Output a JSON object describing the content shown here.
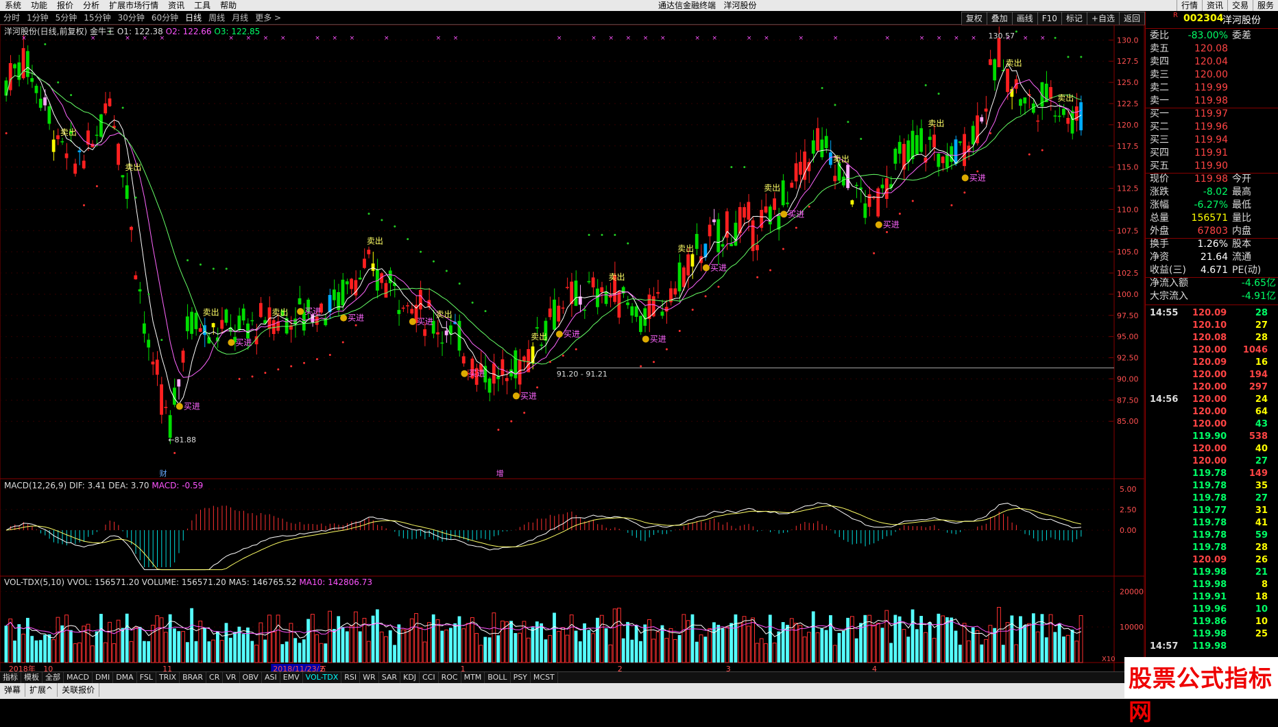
{
  "menu": {
    "items": [
      "系统",
      "功能",
      "报价",
      "分析",
      "扩展市场行情",
      "资讯",
      "工具",
      "帮助"
    ],
    "center_title": "通达信金融终端",
    "center_stock": "洋河股份",
    "right_items": [
      "行情",
      "资讯",
      "交易",
      "服务"
    ]
  },
  "period_tabs": [
    "分时",
    "1分钟",
    "5分钟",
    "15分钟",
    "30分钟",
    "60分钟",
    "日线",
    "周线",
    "月线",
    "更多 >"
  ],
  "active_period": "日线",
  "right_tools": [
    "复权",
    "叠加",
    "画线",
    "F10",
    "标记",
    "+自选",
    "返回"
  ],
  "price_chart": {
    "title_main": "洋河股份(日线,前复权)",
    "title_indicator": "金牛王",
    "o1_label": "O1: 122.38",
    "o2_label": "O2: 122.66",
    "o3_label": "O3: 122.85",
    "y_ticks": [
      "130.0",
      "127.5",
      "125.0",
      "122.5",
      "120.0",
      "117.5",
      "115.0",
      "112.5",
      "110.0",
      "107.5",
      "105.0",
      "102.5",
      "100.0",
      "97.50",
      "95.00",
      "92.50",
      "90.00",
      "87.50",
      "85.00"
    ],
    "low_label": "←81.88",
    "high_label": "130.57",
    "mid_label": "91.20 - 91.21",
    "buy_text": "买进",
    "sell_text": "卖出",
    "finance_marker": "财",
    "add_marker": "增"
  },
  "macd": {
    "title": "MACD(12,26,9)",
    "dif": "DIF: 3.41",
    "dea": "DEA: 3.70",
    "macd": "MACD: -0.59",
    "y_ticks": [
      "5.00",
      "2.50",
      "0.00"
    ]
  },
  "volume": {
    "title": "VOL-TDX(5,10)",
    "vvol": "VVOL: 156571.20",
    "volume": "VOLUME: 156571.20",
    "ma5": "MA5: 146765.52",
    "ma10": "MA10: 142806.73",
    "y_ticks": [
      "20000",
      "10000"
    ],
    "unit": "X10"
  },
  "x_axis": {
    "labels": [
      "2018年",
      "10",
      "11",
      "2018/11/23/五",
      "2",
      "1",
      "2",
      "3",
      "4"
    ]
  },
  "indicator_tabs": [
    "指标",
    "模板",
    "全部",
    "MACD",
    "DMI",
    "DMA",
    "FSL",
    "TRIX",
    "BRAR",
    "CR",
    "VR",
    "OBV",
    "ASI",
    "EMV",
    "VOL-TDX",
    "RSI",
    "WR",
    "SAR",
    "KDJ",
    "CCI",
    "ROC",
    "MTM",
    "BOLL",
    "PSY",
    "MCST"
  ],
  "active_indicator_tab": "VOL-TDX",
  "status_items": [
    "弹幕",
    "扩展^",
    "关联报价"
  ],
  "quote_panel": {
    "mark": "R",
    "code": "002304",
    "name": "洋河股份",
    "weibi_label": "委比",
    "weibi": "-83.00%",
    "weicha_label": "委差",
    "asks": [
      {
        "label": "卖五",
        "price": "120.08"
      },
      {
        "label": "卖四",
        "price": "120.04"
      },
      {
        "label": "卖三",
        "price": "120.00"
      },
      {
        "label": "卖二",
        "price": "119.99"
      },
      {
        "label": "卖一",
        "price": "119.98"
      }
    ],
    "bids": [
      {
        "label": "买一",
        "price": "119.97"
      },
      {
        "label": "买二",
        "price": "119.96"
      },
      {
        "label": "买三",
        "price": "119.94"
      },
      {
        "label": "买四",
        "price": "119.91"
      },
      {
        "label": "买五",
        "price": "119.90"
      }
    ],
    "stats": [
      {
        "l": "现价",
        "v": "119.98",
        "l2": "今开"
      },
      {
        "l": "涨跌",
        "v": "-8.02",
        "l2": "最高"
      },
      {
        "l": "涨幅",
        "v": "-6.27%",
        "l2": "最低"
      },
      {
        "l": "总量",
        "v": "156571",
        "l2": "量比"
      },
      {
        "l": "外盘",
        "v": "67803",
        "l2": "内盘"
      }
    ],
    "stats2": [
      {
        "l": "换手",
        "v": "1.26%",
        "l2": "股本"
      },
      {
        "l": "净资",
        "v": "21.64",
        "l2": "流通"
      },
      {
        "l": "收益(三)",
        "v": "4.671",
        "l2": "PE(动)"
      }
    ],
    "flows": [
      {
        "l": "净流入额",
        "v": "-4.65亿"
      },
      {
        "l": "大宗流入",
        "v": "-4.91亿"
      }
    ],
    "ticks": [
      {
        "t": "14:55",
        "p": "120.09",
        "q": "28"
      },
      {
        "t": "",
        "p": "120.10",
        "q": "27"
      },
      {
        "t": "",
        "p": "120.08",
        "q": "28"
      },
      {
        "t": "",
        "p": "120.00",
        "q": "1046"
      },
      {
        "t": "",
        "p": "120.09",
        "q": "16"
      },
      {
        "t": "",
        "p": "120.00",
        "q": "194"
      },
      {
        "t": "",
        "p": "120.00",
        "q": "297"
      },
      {
        "t": "14:56",
        "p": "120.00",
        "q": "24"
      },
      {
        "t": "",
        "p": "120.00",
        "q": "64"
      },
      {
        "t": "",
        "p": "120.00",
        "q": "43"
      },
      {
        "t": "",
        "p": "119.90",
        "q": "538"
      },
      {
        "t": "",
        "p": "120.00",
        "q": "40"
      },
      {
        "t": "",
        "p": "120.00",
        "q": "27"
      },
      {
        "t": "",
        "p": "119.78",
        "q": "149"
      },
      {
        "t": "",
        "p": "119.78",
        "q": "35"
      },
      {
        "t": "",
        "p": "119.78",
        "q": "27"
      },
      {
        "t": "",
        "p": "119.77",
        "q": "31"
      },
      {
        "t": "",
        "p": "119.78",
        "q": "41"
      },
      {
        "t": "",
        "p": "119.78",
        "q": "59"
      },
      {
        "t": "",
        "p": "119.78",
        "q": "28"
      },
      {
        "t": "",
        "p": "120.09",
        "q": "26"
      },
      {
        "t": "",
        "p": "119.98",
        "q": "21"
      },
      {
        "t": "",
        "p": "119.98",
        "q": "8"
      },
      {
        "t": "",
        "p": "119.91",
        "q": "18"
      },
      {
        "t": "",
        "p": "119.96",
        "q": "10"
      },
      {
        "t": "",
        "p": "119.86",
        "q": "10"
      },
      {
        "t": "",
        "p": "119.98",
        "q": "25"
      },
      {
        "t": "14:57",
        "p": "119.98",
        "q": ""
      }
    ]
  },
  "watermark": "股票公式指标网",
  "colors": {
    "up": "#ff2020",
    "down": "#00dd00",
    "blue": "#00aaff",
    "pink": "#ffaaff",
    "yellow": "#ffff00"
  }
}
